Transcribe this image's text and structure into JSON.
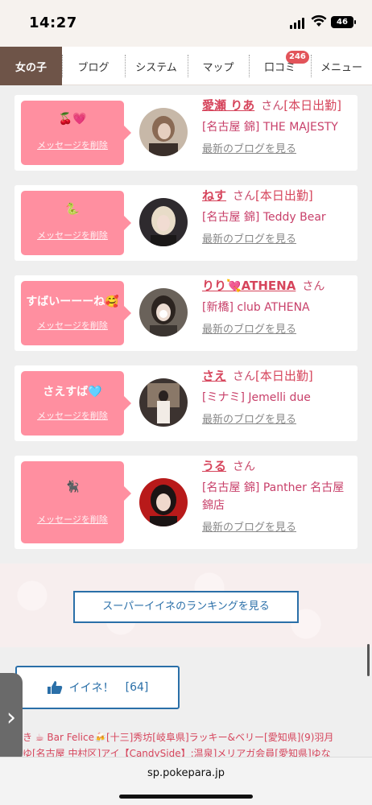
{
  "status": {
    "time": "14:27",
    "battery": "46"
  },
  "nav": {
    "items": [
      {
        "label": "女の子",
        "active": true
      },
      {
        "label": "ブログ"
      },
      {
        "label": "システム"
      },
      {
        "label": "マップ"
      },
      {
        "label": "口コミ",
        "badge": "246"
      },
      {
        "label": "メニュー"
      }
    ]
  },
  "delete_label": "メッセージを削除",
  "san_label": "さん",
  "blog_label": "最新のブログを見る",
  "cards": [
    {
      "message": "🍒💗",
      "name": "愛瀬 りあ",
      "status": "[本日出勤]",
      "shop": "[名古屋 錦] THE MAJESTY",
      "shop2": ""
    },
    {
      "message": "🐍",
      "name": "ねす",
      "status": "[本日出勤]",
      "shop": "[名古屋 錦] Teddy Bear",
      "shop2": ""
    },
    {
      "message": "すばいーーーね🥰",
      "name": "りり💘ATHENA",
      "status": "",
      "shop": "[新橋] club ATHENA",
      "shop2": ""
    },
    {
      "message": "さえすば🩵",
      "name": "さえ",
      "status": "[本日出勤]",
      "shop": "[ミナミ] Jemelli due",
      "shop2": ""
    },
    {
      "message": "🐈‍⬛",
      "name": "うる",
      "status": "",
      "shop": "[名古屋 錦] Panther 名古屋",
      "shop2": "錦店"
    }
  ],
  "ranking_button": "スーパーイイネのランキングを見る",
  "like_button": {
    "label": "イイネ！",
    "count": "[64]"
  },
  "ticker": {
    "line1": "き ☕ Bar Felice🍻[十三]秀坊[岐阜県]ラッキー&ベリー[愛知県](9)羽月",
    "line2": "ゆ[名古屋 中村区]アイ【CandySide】:温泉]メリアガ会員[愛知県]ゆな"
  },
  "url": "sp.pokepara.jp",
  "colors": {
    "nav_active": "#6e5448",
    "bubble": "#ff8fa0",
    "accent_pink": "#d6455c",
    "button_blue": "#2a6fa8",
    "badge": "#e2545a"
  }
}
